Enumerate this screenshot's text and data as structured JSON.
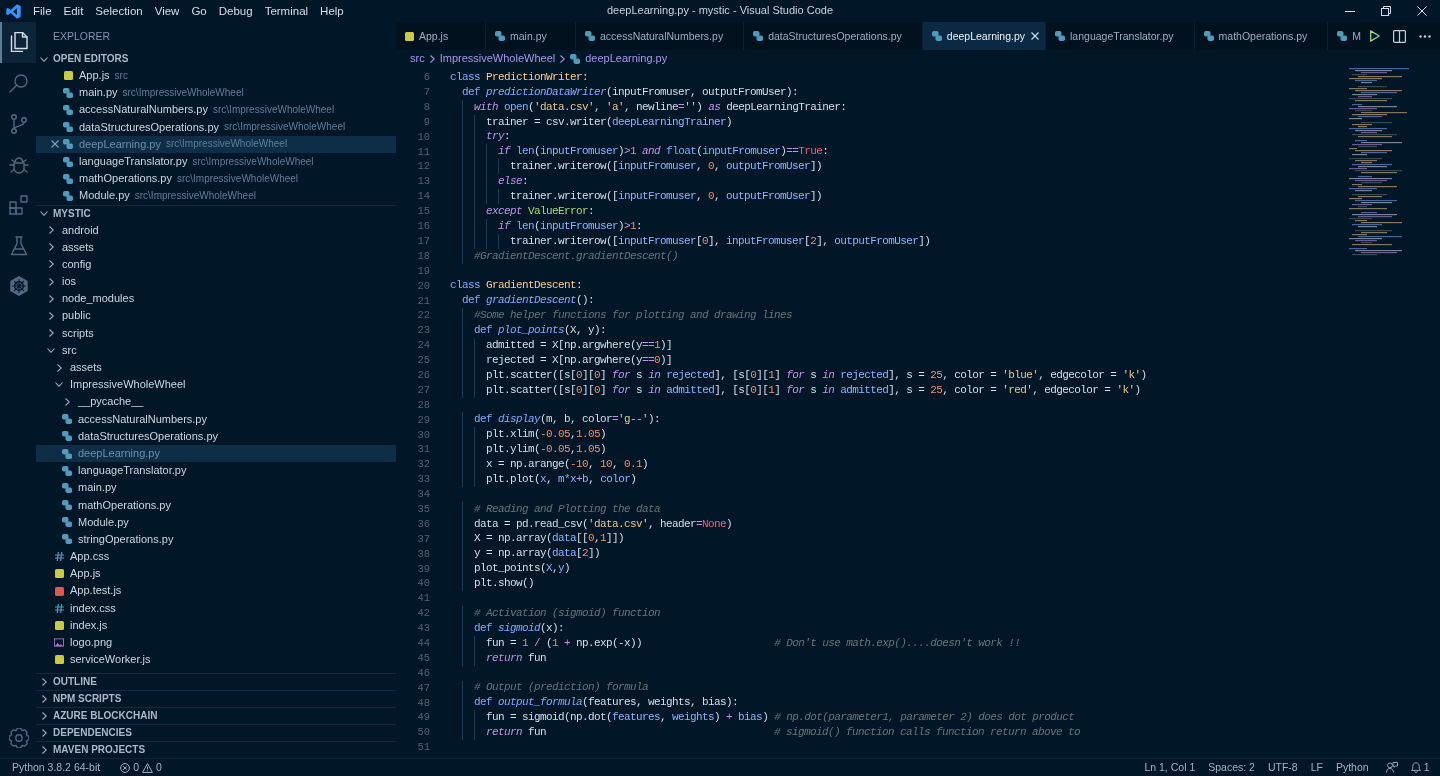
{
  "title_bar": {
    "menu": [
      "File",
      "Edit",
      "Selection",
      "View",
      "Go",
      "Debug",
      "Terminal",
      "Help"
    ],
    "title": "deepLearning.py - mystic - Visual Studio Code"
  },
  "activity_bar": {
    "items": [
      {
        "kind": "files",
        "selected": true
      },
      {
        "kind": "search",
        "selected": false
      },
      {
        "kind": "source-control",
        "selected": false
      },
      {
        "kind": "debug",
        "selected": false
      },
      {
        "kind": "extensions",
        "selected": false
      },
      {
        "kind": "flask",
        "selected": false
      },
      {
        "kind": "ship-wheel",
        "selected": false
      }
    ],
    "bottom": [
      {
        "kind": "settings"
      }
    ]
  },
  "sidebar": {
    "title": "EXPLORER",
    "open_editors": {
      "label": "OPEN EDITORS",
      "expanded": true,
      "items": [
        {
          "name": "App.js",
          "path": "src",
          "kind": "js",
          "selected": false
        },
        {
          "name": "main.py",
          "path": "src\\ImpressiveWholeWheel",
          "kind": "python",
          "selected": false
        },
        {
          "name": "accessNaturalNumbers.py",
          "path": "src\\ImpressiveWholeWheel",
          "kind": "python",
          "selected": false
        },
        {
          "name": "dataStructuresOperations.py",
          "path": "src\\ImpressiveWholeWheel",
          "kind": "python",
          "selected": false
        },
        {
          "name": "deepLearning.py",
          "path": "src\\ImpressiveWholeWheel",
          "kind": "python",
          "selected": true
        },
        {
          "name": "languageTranslator.py",
          "path": "src\\ImpressiveWholeWheel",
          "kind": "python",
          "selected": false
        },
        {
          "name": "mathOperations.py",
          "path": "src\\ImpressiveWholeWheel",
          "kind": "python",
          "selected": false
        },
        {
          "name": "Module.py",
          "path": "src\\ImpressiveWholeWheel",
          "kind": "python",
          "selected": false
        }
      ]
    },
    "project": {
      "label": "MYSTIC",
      "expanded": true,
      "tree": [
        {
          "name": "android",
          "kind": "folder",
          "expanded": false,
          "selected": false
        },
        {
          "name": "assets",
          "kind": "folder",
          "expanded": false,
          "selected": false
        },
        {
          "name": "config",
          "kind": "folder",
          "expanded": false,
          "selected": false
        },
        {
          "name": "ios",
          "kind": "folder",
          "expanded": false,
          "selected": false
        },
        {
          "name": "node_modules",
          "kind": "folder",
          "expanded": false,
          "selected": false
        },
        {
          "name": "public",
          "kind": "folder",
          "expanded": false,
          "selected": false
        },
        {
          "name": "scripts",
          "kind": "folder",
          "expanded": false,
          "selected": false
        },
        {
          "name": "src",
          "kind": "folder",
          "expanded": true,
          "selected": false,
          "children": [
            {
              "name": "assets",
              "kind": "folder",
              "expanded": false,
              "selected": false
            },
            {
              "name": "ImpressiveWholeWheel",
              "kind": "folder",
              "expanded": true,
              "selected": false,
              "children": [
                {
                  "name": "__pycache__",
                  "kind": "folder",
                  "expanded": false,
                  "selected": false
                },
                {
                  "name": "accessNaturalNumbers.py",
                  "kind": "python",
                  "selected": false
                },
                {
                  "name": "dataStructuresOperations.py",
                  "kind": "python",
                  "selected": false
                },
                {
                  "name": "deepLearning.py",
                  "kind": "python",
                  "selected": true
                },
                {
                  "name": "languageTranslator.py",
                  "kind": "python",
                  "selected": false
                },
                {
                  "name": "main.py",
                  "kind": "python",
                  "selected": false
                },
                {
                  "name": "mathOperations.py",
                  "kind": "python",
                  "selected": false
                },
                {
                  "name": "Module.py",
                  "kind": "python",
                  "selected": false
                },
                {
                  "name": "stringOperations.py",
                  "kind": "python",
                  "selected": false
                }
              ]
            },
            {
              "name": "App.css",
              "kind": "css",
              "selected": false
            },
            {
              "name": "App.js",
              "kind": "js",
              "selected": false
            },
            {
              "name": "App.test.js",
              "kind": "test",
              "selected": false
            },
            {
              "name": "index.css",
              "kind": "css",
              "selected": false
            },
            {
              "name": "index.js",
              "kind": "js",
              "selected": false
            },
            {
              "name": "logo.png",
              "kind": "image",
              "selected": false
            },
            {
              "name": "serviceWorker.js",
              "kind": "js",
              "selected": false
            }
          ]
        }
      ]
    },
    "sections": [
      {
        "label": "OUTLINE",
        "expanded": false
      },
      {
        "label": "NPM SCRIPTS",
        "expanded": false
      },
      {
        "label": "AZURE BLOCKCHAIN",
        "expanded": false
      },
      {
        "label": "DEPENDENCIES",
        "expanded": false
      },
      {
        "label": "MAVEN PROJECTS",
        "expanded": false
      }
    ]
  },
  "editor": {
    "tabs": [
      {
        "label": "App.js",
        "kind": "js",
        "selected": false
      },
      {
        "label": "main.py",
        "kind": "python",
        "selected": false
      },
      {
        "label": "accessNaturalNumbers.py",
        "kind": "python",
        "selected": false
      },
      {
        "label": "dataStructuresOperations.py",
        "kind": "python",
        "selected": false
      },
      {
        "label": "deepLearning.py",
        "kind": "python",
        "selected": true
      },
      {
        "label": "languageTranslator.py",
        "kind": "python",
        "selected": false
      },
      {
        "label": "mathOperations.py",
        "kind": "python",
        "selected": false
      },
      {
        "label": "M",
        "kind": "python",
        "selected": false
      }
    ],
    "breadcrumb": [
      {
        "label": "src",
        "kind": "folder"
      },
      {
        "label": "ImpressiveWholeWheel",
        "kind": "folder"
      },
      {
        "label": "deepLearning.py",
        "kind": "python"
      }
    ],
    "lines": [
      {
        "number": "6",
        "tokens": [
          {
            "kind": "keyword",
            "text": "class "
          },
          {
            "kind": "class",
            "text": "PredictionWriter"
          },
          {
            "kind": "text",
            "text": ":"
          }
        ]
      },
      {
        "number": "7",
        "tokens": [
          {
            "kind": "keyword",
            "text": "  def "
          },
          {
            "kind": "function",
            "text": "predictionDataWriter"
          },
          {
            "kind": "text",
            "text": "(inputFromuser, outputFromUser):"
          }
        ]
      },
      {
        "number": "8",
        "tokens": [
          {
            "kind": "control",
            "text": "    with "
          },
          {
            "kind": "builtin",
            "text": "open"
          },
          {
            "kind": "text",
            "text": "("
          },
          {
            "kind": "string",
            "text": "'data.csv'"
          },
          {
            "kind": "text",
            "text": ", "
          },
          {
            "kind": "string",
            "text": "'a'"
          },
          {
            "kind": "text",
            "text": ", newline"
          },
          {
            "kind": "operator",
            "text": "="
          },
          {
            "kind": "string",
            "text": "''"
          },
          {
            "kind": "text",
            "text": ") "
          },
          {
            "kind": "control",
            "text": "as"
          },
          {
            "kind": "text",
            "text": " deepLearningTrainer:"
          }
        ]
      },
      {
        "number": "9",
        "tokens": [
          {
            "kind": "text",
            "text": "      trainer = csv.writer("
          },
          {
            "kind": "name",
            "text": "deepLearningTrainer"
          },
          {
            "kind": "text",
            "text": ")"
          }
        ]
      },
      {
        "number": "10",
        "tokens": [
          {
            "kind": "control",
            "text": "      try"
          },
          {
            "kind": "text",
            "text": ":"
          }
        ]
      },
      {
        "number": "11",
        "tokens": [
          {
            "kind": "control",
            "text": "        if "
          },
          {
            "kind": "builtin",
            "text": "len"
          },
          {
            "kind": "text",
            "text": "("
          },
          {
            "kind": "name",
            "text": "inputFromuser"
          },
          {
            "kind": "text",
            "text": ")"
          },
          {
            "kind": "operator",
            "text": ">"
          },
          {
            "kind": "number",
            "text": "1 "
          },
          {
            "kind": "control",
            "text": "and "
          },
          {
            "kind": "builtin",
            "text": "float"
          },
          {
            "kind": "text",
            "text": "("
          },
          {
            "kind": "name",
            "text": "inputFromuser"
          },
          {
            "kind": "text",
            "text": ")"
          },
          {
            "kind": "operator",
            "text": "=="
          },
          {
            "kind": "constant",
            "text": "True"
          },
          {
            "kind": "text",
            "text": ":"
          }
        ]
      },
      {
        "number": "12",
        "tokens": [
          {
            "kind": "text",
            "text": "          trainer.writerow(["
          },
          {
            "kind": "name",
            "text": "inputFromuser"
          },
          {
            "kind": "text",
            "text": ", "
          },
          {
            "kind": "number",
            "text": "0"
          },
          {
            "kind": "text",
            "text": ", "
          },
          {
            "kind": "name",
            "text": "outputFromUser"
          },
          {
            "kind": "text",
            "text": "])"
          }
        ]
      },
      {
        "number": "13",
        "tokens": [
          {
            "kind": "control",
            "text": "        else"
          },
          {
            "kind": "text",
            "text": ":"
          }
        ]
      },
      {
        "number": "14",
        "tokens": [
          {
            "kind": "text",
            "text": "          trainer.writerow(["
          },
          {
            "kind": "name",
            "text": "inputFromuser"
          },
          {
            "kind": "text",
            "text": ", "
          },
          {
            "kind": "number",
            "text": "0"
          },
          {
            "kind": "text",
            "text": ", "
          },
          {
            "kind": "name",
            "text": "outputFromUser"
          },
          {
            "kind": "text",
            "text": "])"
          }
        ]
      },
      {
        "number": "15",
        "tokens": [
          {
            "kind": "control",
            "text": "      except "
          },
          {
            "kind": "type",
            "text": "ValueError"
          },
          {
            "kind": "text",
            "text": ":"
          }
        ]
      },
      {
        "number": "16",
        "tokens": [
          {
            "kind": "control",
            "text": "        if "
          },
          {
            "kind": "builtin",
            "text": "len"
          },
          {
            "kind": "text",
            "text": "("
          },
          {
            "kind": "name",
            "text": "inputFromuser"
          },
          {
            "kind": "text",
            "text": ")"
          },
          {
            "kind": "operator",
            "text": ">"
          },
          {
            "kind": "number",
            "text": "1"
          },
          {
            "kind": "text",
            "text": ":"
          }
        ]
      },
      {
        "number": "17",
        "tokens": [
          {
            "kind": "text",
            "text": "          trainer.writerow(["
          },
          {
            "kind": "name",
            "text": "inputFromuser"
          },
          {
            "kind": "text",
            "text": "["
          },
          {
            "kind": "number",
            "text": "0"
          },
          {
            "kind": "text",
            "text": "], "
          },
          {
            "kind": "name",
            "text": "inputFromuser"
          },
          {
            "kind": "text",
            "text": "["
          },
          {
            "kind": "number",
            "text": "2"
          },
          {
            "kind": "text",
            "text": "], "
          },
          {
            "kind": "name",
            "text": "outputFromUser"
          },
          {
            "kind": "text",
            "text": "])"
          }
        ]
      },
      {
        "number": "18",
        "tokens": [
          {
            "kind": "comment",
            "text": "    #GradientDescent.gradientDescent()"
          }
        ]
      },
      {
        "number": "19"
      },
      {
        "number": "20",
        "tokens": [
          {
            "kind": "keyword",
            "text": "class "
          },
          {
            "kind": "class",
            "text": "GradientDescent"
          },
          {
            "kind": "text",
            "text": ":"
          }
        ]
      },
      {
        "number": "21",
        "tokens": [
          {
            "kind": "keyword",
            "text": "  def "
          },
          {
            "kind": "function",
            "text": "gradientDescent"
          },
          {
            "kind": "text",
            "text": "():"
          }
        ]
      },
      {
        "number": "22",
        "tokens": [
          {
            "kind": "comment",
            "text": "    #Some helper functions for plotting and drawing lines"
          }
        ]
      },
      {
        "number": "23",
        "tokens": [
          {
            "kind": "keyword",
            "text": "    def "
          },
          {
            "kind": "function",
            "text": "plot_points"
          },
          {
            "kind": "text",
            "text": "(X, y):"
          }
        ]
      },
      {
        "number": "24",
        "tokens": [
          {
            "kind": "text",
            "text": "      admitted = X[np.argwhere(y"
          },
          {
            "kind": "operator",
            "text": "=="
          },
          {
            "kind": "number",
            "text": "1"
          },
          {
            "kind": "text",
            "text": ")]"
          }
        ]
      },
      {
        "number": "25",
        "tokens": [
          {
            "kind": "text",
            "text": "      rejected = X[np.argwhere(y"
          },
          {
            "kind": "operator",
            "text": "=="
          },
          {
            "kind": "number",
            "text": "0"
          },
          {
            "kind": "text",
            "text": ")]"
          }
        ]
      },
      {
        "number": "26",
        "tokens": [
          {
            "kind": "text",
            "text": "      plt.scatter([s["
          },
          {
            "kind": "number",
            "text": "0"
          },
          {
            "kind": "text",
            "text": "]["
          },
          {
            "kind": "number",
            "text": "0"
          },
          {
            "kind": "text",
            "text": "] "
          },
          {
            "kind": "control",
            "text": "for"
          },
          {
            "kind": "text",
            "text": " s "
          },
          {
            "kind": "control",
            "text": "in "
          },
          {
            "kind": "name",
            "text": "rejected"
          },
          {
            "kind": "text",
            "text": "], [s["
          },
          {
            "kind": "number",
            "text": "0"
          },
          {
            "kind": "text",
            "text": "]["
          },
          {
            "kind": "number",
            "text": "1"
          },
          {
            "kind": "text",
            "text": "] "
          },
          {
            "kind": "control",
            "text": "for"
          },
          {
            "kind": "text",
            "text": " s "
          },
          {
            "kind": "control",
            "text": "in "
          },
          {
            "kind": "name",
            "text": "rejected"
          },
          {
            "kind": "text",
            "text": "], s = "
          },
          {
            "kind": "number",
            "text": "25"
          },
          {
            "kind": "text",
            "text": ", color = "
          },
          {
            "kind": "string",
            "text": "'blue'"
          },
          {
            "kind": "text",
            "text": ", edgecolor = "
          },
          {
            "kind": "string",
            "text": "'k'"
          },
          {
            "kind": "text",
            "text": ")"
          }
        ]
      },
      {
        "number": "27",
        "tokens": [
          {
            "kind": "text",
            "text": "      plt.scatter([s["
          },
          {
            "kind": "number",
            "text": "0"
          },
          {
            "kind": "text",
            "text": "]["
          },
          {
            "kind": "number",
            "text": "0"
          },
          {
            "kind": "text",
            "text": "] "
          },
          {
            "kind": "control",
            "text": "for"
          },
          {
            "kind": "text",
            "text": " s "
          },
          {
            "kind": "control",
            "text": "in "
          },
          {
            "kind": "name",
            "text": "admitted"
          },
          {
            "kind": "text",
            "text": "], [s["
          },
          {
            "kind": "number",
            "text": "0"
          },
          {
            "kind": "text",
            "text": "]["
          },
          {
            "kind": "number",
            "text": "1"
          },
          {
            "kind": "text",
            "text": "] "
          },
          {
            "kind": "control",
            "text": "for"
          },
          {
            "kind": "text",
            "text": " s "
          },
          {
            "kind": "control",
            "text": "in "
          },
          {
            "kind": "name",
            "text": "admitted"
          },
          {
            "kind": "text",
            "text": "], s = "
          },
          {
            "kind": "number",
            "text": "25"
          },
          {
            "kind": "text",
            "text": ", color = "
          },
          {
            "kind": "string",
            "text": "'red'"
          },
          {
            "kind": "text",
            "text": ", edgecolor = "
          },
          {
            "kind": "string",
            "text": "'k'"
          },
          {
            "kind": "text",
            "text": ")"
          }
        ]
      },
      {
        "number": "28"
      },
      {
        "number": "29",
        "tokens": [
          {
            "kind": "keyword",
            "text": "    def "
          },
          {
            "kind": "function",
            "text": "display"
          },
          {
            "kind": "text",
            "text": "(m, b, color"
          },
          {
            "kind": "operator",
            "text": "="
          },
          {
            "kind": "string",
            "text": "'g--'"
          },
          {
            "kind": "text",
            "text": "):"
          }
        ]
      },
      {
        "number": "30",
        "tokens": [
          {
            "kind": "text",
            "text": "      plt.xlim("
          },
          {
            "kind": "number",
            "text": "-0.05"
          },
          {
            "kind": "text",
            "text": ","
          },
          {
            "kind": "number",
            "text": "1.05"
          },
          {
            "kind": "text",
            "text": ")"
          }
        ]
      },
      {
        "number": "31",
        "tokens": [
          {
            "kind": "text",
            "text": "      plt.ylim("
          },
          {
            "kind": "number",
            "text": "-0.05"
          },
          {
            "kind": "text",
            "text": ","
          },
          {
            "kind": "number",
            "text": "1.05"
          },
          {
            "kind": "text",
            "text": ")"
          }
        ]
      },
      {
        "number": "32",
        "tokens": [
          {
            "kind": "text",
            "text": "      x = np.arange("
          },
          {
            "kind": "number",
            "text": "-10"
          },
          {
            "kind": "text",
            "text": ", "
          },
          {
            "kind": "number",
            "text": "10"
          },
          {
            "kind": "text",
            "text": ", "
          },
          {
            "kind": "number",
            "text": "0.1"
          },
          {
            "kind": "text",
            "text": ")"
          }
        ]
      },
      {
        "number": "33",
        "tokens": [
          {
            "kind": "text",
            "text": "      plt.plot("
          },
          {
            "kind": "name",
            "text": "x"
          },
          {
            "kind": "text",
            "text": ", "
          },
          {
            "kind": "name",
            "text": "m"
          },
          {
            "kind": "operator",
            "text": "*"
          },
          {
            "kind": "name",
            "text": "x"
          },
          {
            "kind": "operator",
            "text": "+"
          },
          {
            "kind": "name",
            "text": "b"
          },
          {
            "kind": "text",
            "text": ", "
          },
          {
            "kind": "name",
            "text": "color"
          },
          {
            "kind": "text",
            "text": ")"
          }
        ]
      },
      {
        "number": "34"
      },
      {
        "number": "35",
        "tokens": [
          {
            "kind": "comment",
            "text": "    # Reading and Plotting the data"
          }
        ]
      },
      {
        "number": "36",
        "tokens": [
          {
            "kind": "text",
            "text": "    data = pd.read_csv("
          },
          {
            "kind": "string",
            "text": "'data.csv'"
          },
          {
            "kind": "text",
            "text": ", header"
          },
          {
            "kind": "operator",
            "text": "="
          },
          {
            "kind": "constant",
            "text": "None"
          },
          {
            "kind": "text",
            "text": ")"
          }
        ]
      },
      {
        "number": "37",
        "tokens": [
          {
            "kind": "text",
            "text": "    X = np.array("
          },
          {
            "kind": "name",
            "text": "data"
          },
          {
            "kind": "text",
            "text": "[["
          },
          {
            "kind": "number",
            "text": "0"
          },
          {
            "kind": "text",
            "text": ","
          },
          {
            "kind": "number",
            "text": "1"
          },
          {
            "kind": "text",
            "text": "]])"
          }
        ]
      },
      {
        "number": "38",
        "tokens": [
          {
            "kind": "text",
            "text": "    y = np.array("
          },
          {
            "kind": "name",
            "text": "data"
          },
          {
            "kind": "text",
            "text": "["
          },
          {
            "kind": "number",
            "text": "2"
          },
          {
            "kind": "text",
            "text": "])"
          }
        ]
      },
      {
        "number": "39",
        "tokens": [
          {
            "kind": "text",
            "text": "    plot_points("
          },
          {
            "kind": "name",
            "text": "X"
          },
          {
            "kind": "text",
            "text": ","
          },
          {
            "kind": "name",
            "text": "y"
          },
          {
            "kind": "text",
            "text": ")"
          }
        ]
      },
      {
        "number": "40",
        "tokens": [
          {
            "kind": "text",
            "text": "    plt.show()"
          }
        ]
      },
      {
        "number": "41"
      },
      {
        "number": "42",
        "tokens": [
          {
            "kind": "comment",
            "text": "    # Activation (sigmoid) function"
          }
        ]
      },
      {
        "number": "43",
        "tokens": [
          {
            "kind": "keyword",
            "text": "    def "
          },
          {
            "kind": "function",
            "text": "sigmoid"
          },
          {
            "kind": "text",
            "text": "(x):"
          }
        ]
      },
      {
        "number": "44",
        "tokens": [
          {
            "kind": "text",
            "text": "      fun = "
          },
          {
            "kind": "number",
            "text": "1"
          },
          {
            "kind": "operator",
            "text": " / "
          },
          {
            "kind": "text",
            "text": "("
          },
          {
            "kind": "number",
            "text": "1"
          },
          {
            "kind": "operator",
            "text": " + "
          },
          {
            "kind": "text",
            "text": "np.exp(-x))                      "
          },
          {
            "kind": "comment",
            "text": "# Don't use math.exp()....doesn't work !!"
          }
        ]
      },
      {
        "number": "45",
        "tokens": [
          {
            "kind": "control",
            "text": "      return"
          },
          {
            "kind": "text",
            "text": " fun"
          }
        ]
      },
      {
        "number": "46"
      },
      {
        "number": "47",
        "tokens": [
          {
            "kind": "comment",
            "text": "    # Output (prediction) formula"
          }
        ]
      },
      {
        "number": "48",
        "tokens": [
          {
            "kind": "keyword",
            "text": "    def "
          },
          {
            "kind": "function",
            "text": "output_formula"
          },
          {
            "kind": "text",
            "text": "(features, weights, bias):"
          }
        ]
      },
      {
        "number": "49",
        "tokens": [
          {
            "kind": "text",
            "text": "      fun = sigmoid(np.dot("
          },
          {
            "kind": "name",
            "text": "features"
          },
          {
            "kind": "text",
            "text": ", "
          },
          {
            "kind": "name",
            "text": "weights"
          },
          {
            "kind": "text",
            "text": ") "
          },
          {
            "kind": "operator",
            "text": "+ "
          },
          {
            "kind": "name",
            "text": "bias"
          },
          {
            "kind": "text",
            "text": ") "
          },
          {
            "kind": "comment",
            "text": "# np.dot(parameter1, parameter 2) does dot product"
          }
        ]
      },
      {
        "number": "50",
        "tokens": [
          {
            "kind": "control",
            "text": "      return"
          },
          {
            "kind": "text",
            "text": " fun                                      "
          },
          {
            "kind": "comment",
            "text": "# sigmoid() function calls function return above to"
          }
        ]
      },
      {
        "number": "51"
      }
    ]
  },
  "status_bar": {
    "interpreter": "Python 3.8.2 64-bit",
    "errors": "0",
    "warnings": "0",
    "items": [
      "Ln 1, Col 1",
      "Spaces: 2",
      "UTF-8",
      "LF",
      "Python"
    ],
    "notifications": "1"
  }
}
